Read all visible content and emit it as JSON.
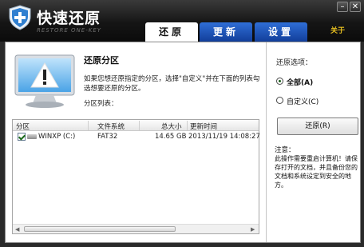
{
  "app": {
    "title": "快速还原",
    "subtitle": "RESTORE ONE-KEY"
  },
  "window_controls": {
    "minimize": "–",
    "close": "✕"
  },
  "tabs": [
    {
      "label": "还原",
      "active": true
    },
    {
      "label": "更新",
      "active": false
    },
    {
      "label": "设置",
      "active": false
    }
  ],
  "about_label": "关于",
  "main": {
    "title": "还原分区",
    "description": "如果您想还原指定的分区，选择\"自定义\"并在下面的列表勾选想要还原的分区。",
    "partition_list_label": "分区列表：",
    "table": {
      "columns": [
        "分区",
        "文件系统",
        "总大小",
        "更新时间"
      ],
      "rows": [
        {
          "partition": "WINXP (C:)",
          "fs": "FAT32",
          "size": "14.65 GB",
          "updated": "2013/11/19 14:08:27",
          "checked": true
        }
      ]
    }
  },
  "options": {
    "label": "还原选项：",
    "all_label": "全部(A)",
    "custom_label": "自定义(C)",
    "selected": "all",
    "restore_button": "还原(R)"
  },
  "note": {
    "title": "注意：",
    "text": "此操作需要重启计算机！请保存打开的文档，并且备份您的文档和系统设定到安全的地方。"
  },
  "colors": {
    "tab_active": "#ffffff",
    "tab_inactive": "#1f56c4",
    "about": "#e8c020",
    "titlebar": "#151515"
  }
}
